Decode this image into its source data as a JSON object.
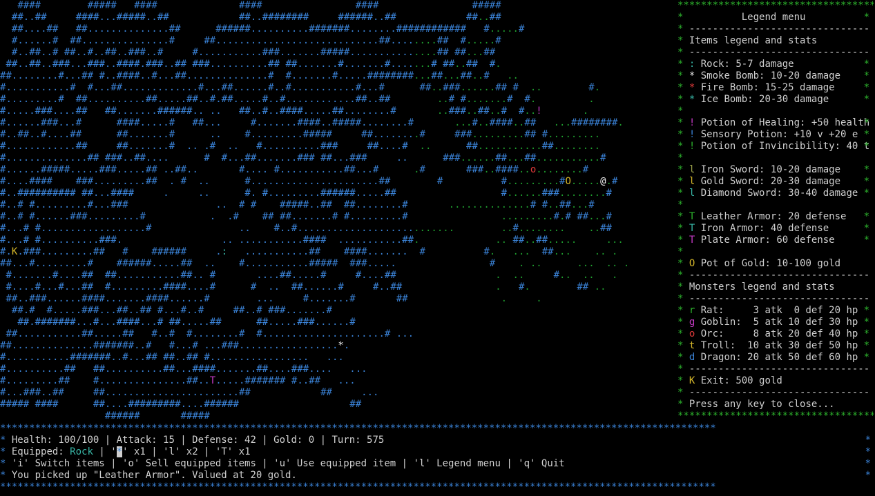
{
  "map": {
    "rows": [
      "   ####        #####   ####              ####                ####                #####",
      "  ##..##     ####...#####..##            ##..########     ######..##            ##..##",
      "  ##....##   ##..............##      ######..........#######........############   #.....#",
      "  #......#  ##...............#     ##............................##........##  #.....#",
      "  #..##..# ##..#..##..###..#     #...........###.......#####...............## ##...##",
      " ##..##..###...###..####.###..## ###..........## ##.......#.......#.......# ##..##  #.",
      "##........#...## #..####..#...##..............#  #.......#.....########...##...##..#   ..",
      "#...........#  #...##.............#...##......#..#...........#...#      ##..###......## #  ..        #.",
      "#.........#  ##..........##.....##..#.##.....#..#............##..##        ..# #.......#  #.         .",
      "#.....###....##   ##.......######.. ..   ##..#..####.....##........#       ..###..##..#  #..!       .",
      "#......###...#      ####.....#   ##...     #.......####..#####........#       ...#..####..##   ...########.",
      "#..##..#....##      ##.......#      ..    #.........#####     ##........#     ###.........## #.........",
      "#............##     ##.......#  .. .#  ..   #..........###     ##....#  ..      ##...........##........",
      "#..............## ###..##....      #  #...##.......### ##...###     ..      ###......##...##...........#",
      "#......#####.....###.....## ..##..       #.... #...........##...#      .#       ###..####..o........#",
      "#....####    ###.........##  . #  ..      #......................##        #          #.........#O.....@.#",
      "#..########## ##...####     .     ..      #. #.........######.....##                  #......###........#",
      "#..# #.........#...###               ..  # #    #####..##  ##........#       ..............# #..##...#",
      "#..# #......###.........#           .  .#    ## ##.......# #.........#                .........#.# ##...#",
      "#...# #..................#               ..    #..#...........................        ..#........    ..##",
      "#...# #..........###.                 .. ...........####  ...........##.             .. ##..##.....     ...",
      "#.K.###.........##   #    ######     .:   ...........##    ####.......  #          #.   ...  ##...    .. .",
      "##...#.........#    ######.....##  ..    #...........#####  ###.....                #    . ..      ...  .. .",
      " #.......#....##  ##...........##.. #       ....##.....#     #....##                 .  ..     #..  ..   .",
      " #....#...#...##  #.........####....#      #  ..  ##......#     #..##                .   #.        ## ..",
      " ##..###......####.......####......#        ...     #.......#       ##                .     .",
      "  ##.#  #.....###...##..## #...#..#     ##..# ###.......#",
      "   ##.#######...#...####...# ##.....##      ##.....###......#",
      " ##...........##.....##   #..#  #........#  #.....................# ...",
      "##..............#######..#   #...# ...###.................*.",
      "#...........#######..#...## ##..## #.................   ...",
      "#..........##   ##..........##...####.......##....###....   ...",
      "#.........##    #...............##..T.....####### #..##   ...",
      "#...###..##     ##.......................##            ##     ...",
      "##### ####      ##....#########....######                   ##",
      "                  ######       #####"
    ]
  },
  "legend": {
    "border": "***********************************",
    "title": "Legend menu",
    "divider": "-------------------------------",
    "items_header": "Items legend and stats",
    "items": [
      {
        "symbol": ":",
        "color": "#38b6a6",
        "text": "Rock: 5-7 damage"
      },
      {
        "symbol": "*",
        "color": "#e8e8e8",
        "text": "Smoke Bomb: 10-20 damage"
      },
      {
        "symbol": "*",
        "color": "#e03a3a",
        "text": "Fire Bomb: 15-25 damage"
      },
      {
        "symbol": "*",
        "color": "#38b6a6",
        "text": "Ice Bomb: 20-30 damage"
      }
    ],
    "potions": [
      {
        "symbol": "!",
        "color": "#c53ac5",
        "text": "Potion of Healing: +50 health"
      },
      {
        "symbol": "!",
        "color": "#3a82d6",
        "text": "Sensory Potion: +10 v +20 e"
      },
      {
        "symbol": "!",
        "color": "#2db32d",
        "text": "Potion of Invincibility: 40 t"
      }
    ],
    "swords": [
      {
        "symbol": "l",
        "color": "#9aa04a",
        "text": "Iron Sword: 10-20 damage"
      },
      {
        "symbol": "l",
        "color": "#d4b62a",
        "text": "Gold Sword: 20-30 damage"
      },
      {
        "symbol": "l",
        "color": "#38b6a6",
        "text": "Diamond Sword: 30-40 damage"
      }
    ],
    "armor": [
      {
        "symbol": "T",
        "color": "#2db32d",
        "text": "Leather Armor: 20 defense"
      },
      {
        "symbol": "T",
        "color": "#38b6a6",
        "text": "Iron Armor: 40 defense"
      },
      {
        "symbol": "T",
        "color": "#c53ac5",
        "text": "Plate Armor: 60 defense"
      }
    ],
    "gold": {
      "symbol": "O",
      "color": "#d4b62a",
      "text": "Pot of Gold: 10-100 gold"
    },
    "monsters_header": "Monsters legend and stats",
    "monsters": [
      {
        "symbol": "r",
        "color": "#2db32d",
        "text": "Rat:     3 atk  0 def 20 hp"
      },
      {
        "symbol": "g",
        "color": "#c53ac5",
        "text": "Goblin:  5 atk 10 def 30 hp"
      },
      {
        "symbol": "o",
        "color": "#e03a3a",
        "text": "Orc:     8 atk 20 def 40 hp"
      },
      {
        "symbol": "t",
        "color": "#d4b62a",
        "text": "Troll:  10 atk 30 def 50 hp"
      },
      {
        "symbol": "d",
        "color": "#3a82d6",
        "text": "Dragon: 20 atk 50 def 60 hp"
      }
    ],
    "exit": {
      "symbol": "K",
      "color": "#d4b62a",
      "text": "Exit: 500 gold"
    },
    "close_hint": "Press any key to close..."
  },
  "status": {
    "border": "***************************************************************************************************************************",
    "stats": "Health: 100/100 | Attack: 15 | Defense: 42 | Gold: 0 | Turn: 575",
    "equipped_label": "Equipped:",
    "equipped_item": "Rock",
    "inventory_pre": "'",
    "inventory_cursor": "*",
    "inventory_post": "' x1 | 'l' x2 | 'T' x1",
    "commands": "'i' Switch items | 'o' Sell equipped items | 'u' Use equipped item | 'l' Legend menu | 'q' Quit",
    "message": "You picked up \"Leather Armor\". Valued at 20 gold."
  }
}
